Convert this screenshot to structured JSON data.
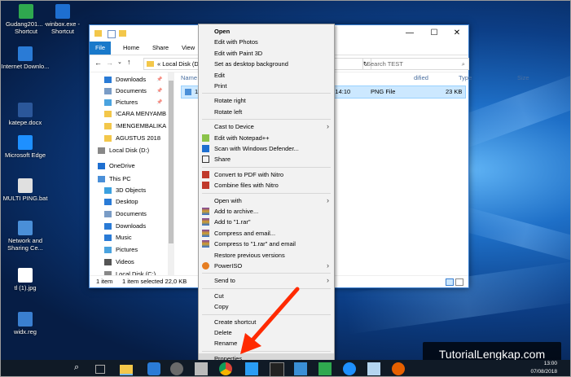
{
  "desktop": {
    "icons": [
      {
        "label": "Gudang201... - Shortcut"
      },
      {
        "label": "winbox.exe - Shortcut"
      },
      {
        "label": "Internet Downlo..."
      },
      {
        "label": "katepe.docx"
      },
      {
        "label": "Microsoft Edge"
      },
      {
        "label": "MULTI PING.bat"
      },
      {
        "label": "Network and Sharing Ce..."
      },
      {
        "label": "tl (1).jpg"
      },
      {
        "label": "widx.reg"
      }
    ]
  },
  "explorer": {
    "ribbon": {
      "file": "File",
      "home": "Home",
      "share": "Share",
      "view": "View"
    },
    "address": "«  Local Disk (D:",
    "search_placeholder": "Search TEST",
    "nav": [
      {
        "label": "Downloads",
        "icon": "download-icon",
        "pin": "📌"
      },
      {
        "label": "Documents",
        "icon": "documents-icon",
        "pin": "📌"
      },
      {
        "label": "Pictures",
        "icon": "pictures-icon",
        "pin": "📌"
      },
      {
        "label": "!CARA MENYAMB",
        "icon": "folder-icon",
        "pin": ""
      },
      {
        "label": "!MENGEMBALIKA",
        "icon": "folder-icon",
        "pin": ""
      },
      {
        "label": "AGUSTUS 2018",
        "icon": "folder-icon",
        "pin": ""
      },
      {
        "label": "Local Disk (D:)",
        "icon": "drive-icon",
        "pin": ""
      },
      {
        "label": "OneDrive",
        "icon": "cloud-icon",
        "pin": ""
      },
      {
        "label": "This PC",
        "icon": "pc-icon",
        "pin": ""
      },
      {
        "label": "3D Objects",
        "icon": "cube-icon",
        "pin": ""
      },
      {
        "label": "Desktop",
        "icon": "desktop-icon",
        "pin": ""
      },
      {
        "label": "Documents",
        "icon": "documents-icon",
        "pin": ""
      },
      {
        "label": "Downloads",
        "icon": "download-icon",
        "pin": ""
      },
      {
        "label": "Music",
        "icon": "music-icon",
        "pin": ""
      },
      {
        "label": "Pictures",
        "icon": "pictures-icon",
        "pin": ""
      },
      {
        "label": "Videos",
        "icon": "video-icon",
        "pin": ""
      },
      {
        "label": "Local Disk (C:)",
        "icon": "drive-icon",
        "pin": ""
      }
    ],
    "columns": {
      "name": "Name",
      "modified": "dified",
      "type": "Type",
      "size": "Size"
    },
    "file": {
      "name": "1.P",
      "modified": "18 14:10",
      "type": "PNG File",
      "size": "23 KB"
    },
    "status": {
      "items": "1 item",
      "selected": "1 item selected  22,0 KB"
    }
  },
  "context_menu": {
    "groups": [
      [
        {
          "label": "Open",
          "bold": true
        },
        {
          "label": "Edit with Photos"
        },
        {
          "label": "Edit with Paint 3D"
        },
        {
          "label": "Set as desktop background"
        },
        {
          "label": "Edit"
        },
        {
          "label": "Print"
        }
      ],
      [
        {
          "label": "Rotate right"
        },
        {
          "label": "Rotate left"
        }
      ],
      [
        {
          "label": "Cast to Device",
          "submenu": true
        },
        {
          "label": "Edit with Notepad++",
          "icon": "notepad-icon"
        },
        {
          "label": "Scan with Windows Defender...",
          "icon": "shield-icon"
        },
        {
          "label": "Share",
          "icon": "share-icon"
        }
      ],
      [
        {
          "label": "Convert to PDF with Nitro",
          "icon": "nitro-icon"
        },
        {
          "label": "Combine files with Nitro",
          "icon": "nitro-icon"
        }
      ],
      [
        {
          "label": "Open with",
          "submenu": true
        },
        {
          "label": "Add to archive...",
          "icon": "winrar-icon"
        },
        {
          "label": "Add to \"1.rar\"",
          "icon": "winrar-icon"
        },
        {
          "label": "Compress and email...",
          "icon": "winrar-icon"
        },
        {
          "label": "Compress to \"1.rar\" and email",
          "icon": "winrar-icon"
        },
        {
          "label": "Restore previous versions"
        },
        {
          "label": "PowerISO",
          "icon": "poweriso-icon",
          "submenu": true
        }
      ],
      [
        {
          "label": "Send to",
          "submenu": true
        }
      ],
      [
        {
          "label": "Cut"
        },
        {
          "label": "Copy"
        }
      ],
      [
        {
          "label": "Create shortcut"
        },
        {
          "label": "Delete"
        },
        {
          "label": "Rename"
        }
      ],
      [
        {
          "label": "Properties",
          "highlight": true
        }
      ]
    ]
  },
  "watermark": "TutorialLengkap.com",
  "clock": {
    "time": "13:00",
    "date": "07/08/2018"
  },
  "colors": {
    "accent": "#1979ca",
    "arrow": "#ff2a00",
    "selection": "#cce8ff"
  }
}
